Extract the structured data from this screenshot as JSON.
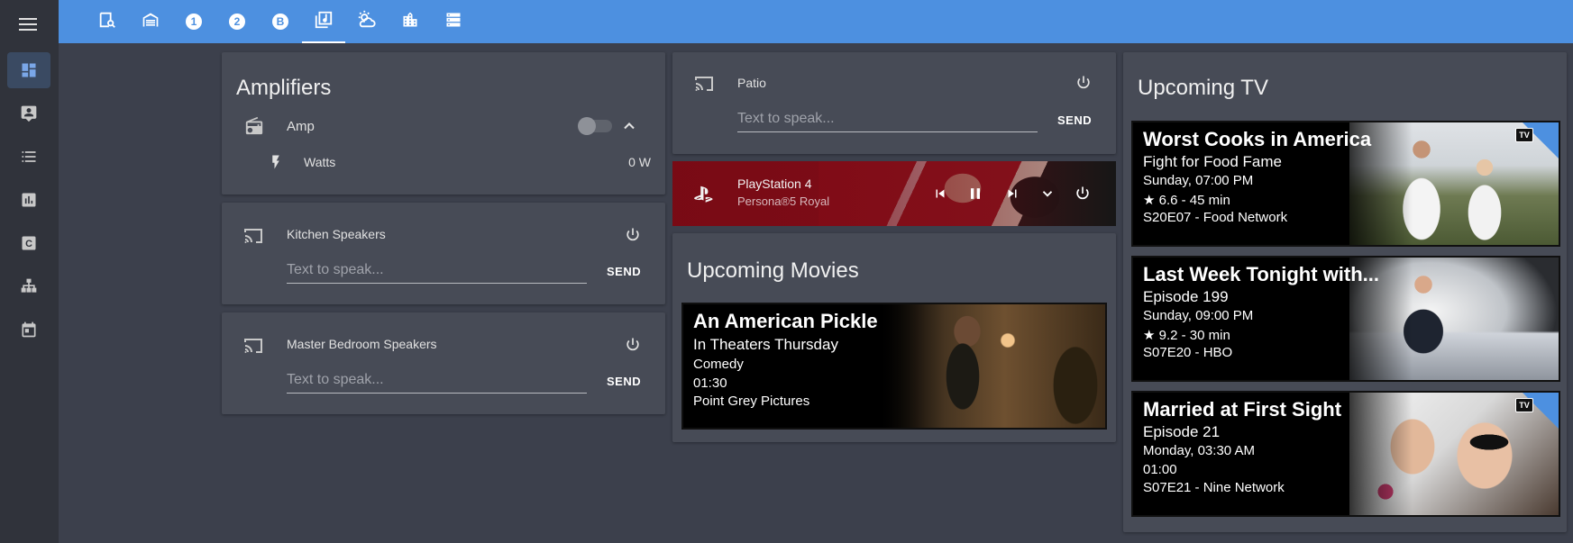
{
  "sidebar": {
    "items": [
      {
        "icon": "dashboard-icon",
        "active": true
      },
      {
        "icon": "account-box-icon"
      },
      {
        "icon": "list-icon"
      },
      {
        "icon": "bar-chart-icon"
      },
      {
        "icon": "c-box-icon"
      },
      {
        "icon": "sitemap-icon"
      },
      {
        "icon": "calendar-icon"
      }
    ]
  },
  "topbar": {
    "tabs": [
      {
        "icon": "home-search-icon"
      },
      {
        "icon": "garage-icon"
      },
      {
        "icon": "numeric-1-icon",
        "label": "1"
      },
      {
        "icon": "numeric-2-icon",
        "label": "2"
      },
      {
        "icon": "letter-b-icon",
        "label": "B"
      },
      {
        "icon": "music-box-icon",
        "active": true
      },
      {
        "icon": "weather-partly-cloudy-icon"
      },
      {
        "icon": "city-icon"
      },
      {
        "icon": "server-icon"
      }
    ]
  },
  "amplifiers": {
    "title": "Amplifiers",
    "amp_label": "Amp",
    "watts_label": "Watts",
    "watts_value": "0 W"
  },
  "kitchen": {
    "name": "Kitchen Speakers",
    "placeholder": "Text to speak...",
    "send": "SEND"
  },
  "master": {
    "name": "Master Bedroom Speakers",
    "placeholder": "Text to speak...",
    "send": "SEND"
  },
  "patio": {
    "name": "Patio",
    "placeholder": "Text to speak...",
    "send": "SEND"
  },
  "media": {
    "title": "PlayStation 4",
    "subtitle": "Persona®5 Royal"
  },
  "movies": {
    "title": "Upcoming Movies",
    "items": [
      {
        "title": "An American Pickle",
        "line1": "In Theaters Thursday",
        "line2": "Comedy",
        "line3": "01:30",
        "line4": "Point Grey Pictures"
      }
    ]
  },
  "tv": {
    "title": "Upcoming TV",
    "items": [
      {
        "title": "Worst Cooks in America",
        "line1": "Fight for Food Fame",
        "line2": "Sunday, 07:00 PM",
        "line3": "★ 6.6 - 45 min",
        "line4": "S20E07 - Food Network",
        "badge": "TV"
      },
      {
        "title": "Last Week Tonight with...",
        "line1": "Episode 199",
        "line2": "Sunday, 09:00 PM",
        "line3": "★ 9.2 - 30 min",
        "line4": "S07E20 - HBO"
      },
      {
        "title": "Married at First Sight",
        "line1": "Episode 21",
        "line2": "Monday, 03:30 AM",
        "line3": "01:00",
        "line4": "S07E21 - Nine Network",
        "badge": "TV"
      }
    ]
  },
  "colors": {
    "topbar": "#4d90e0",
    "card": "#474b56",
    "background": "#3c404c",
    "sidebar": "#30333b"
  }
}
